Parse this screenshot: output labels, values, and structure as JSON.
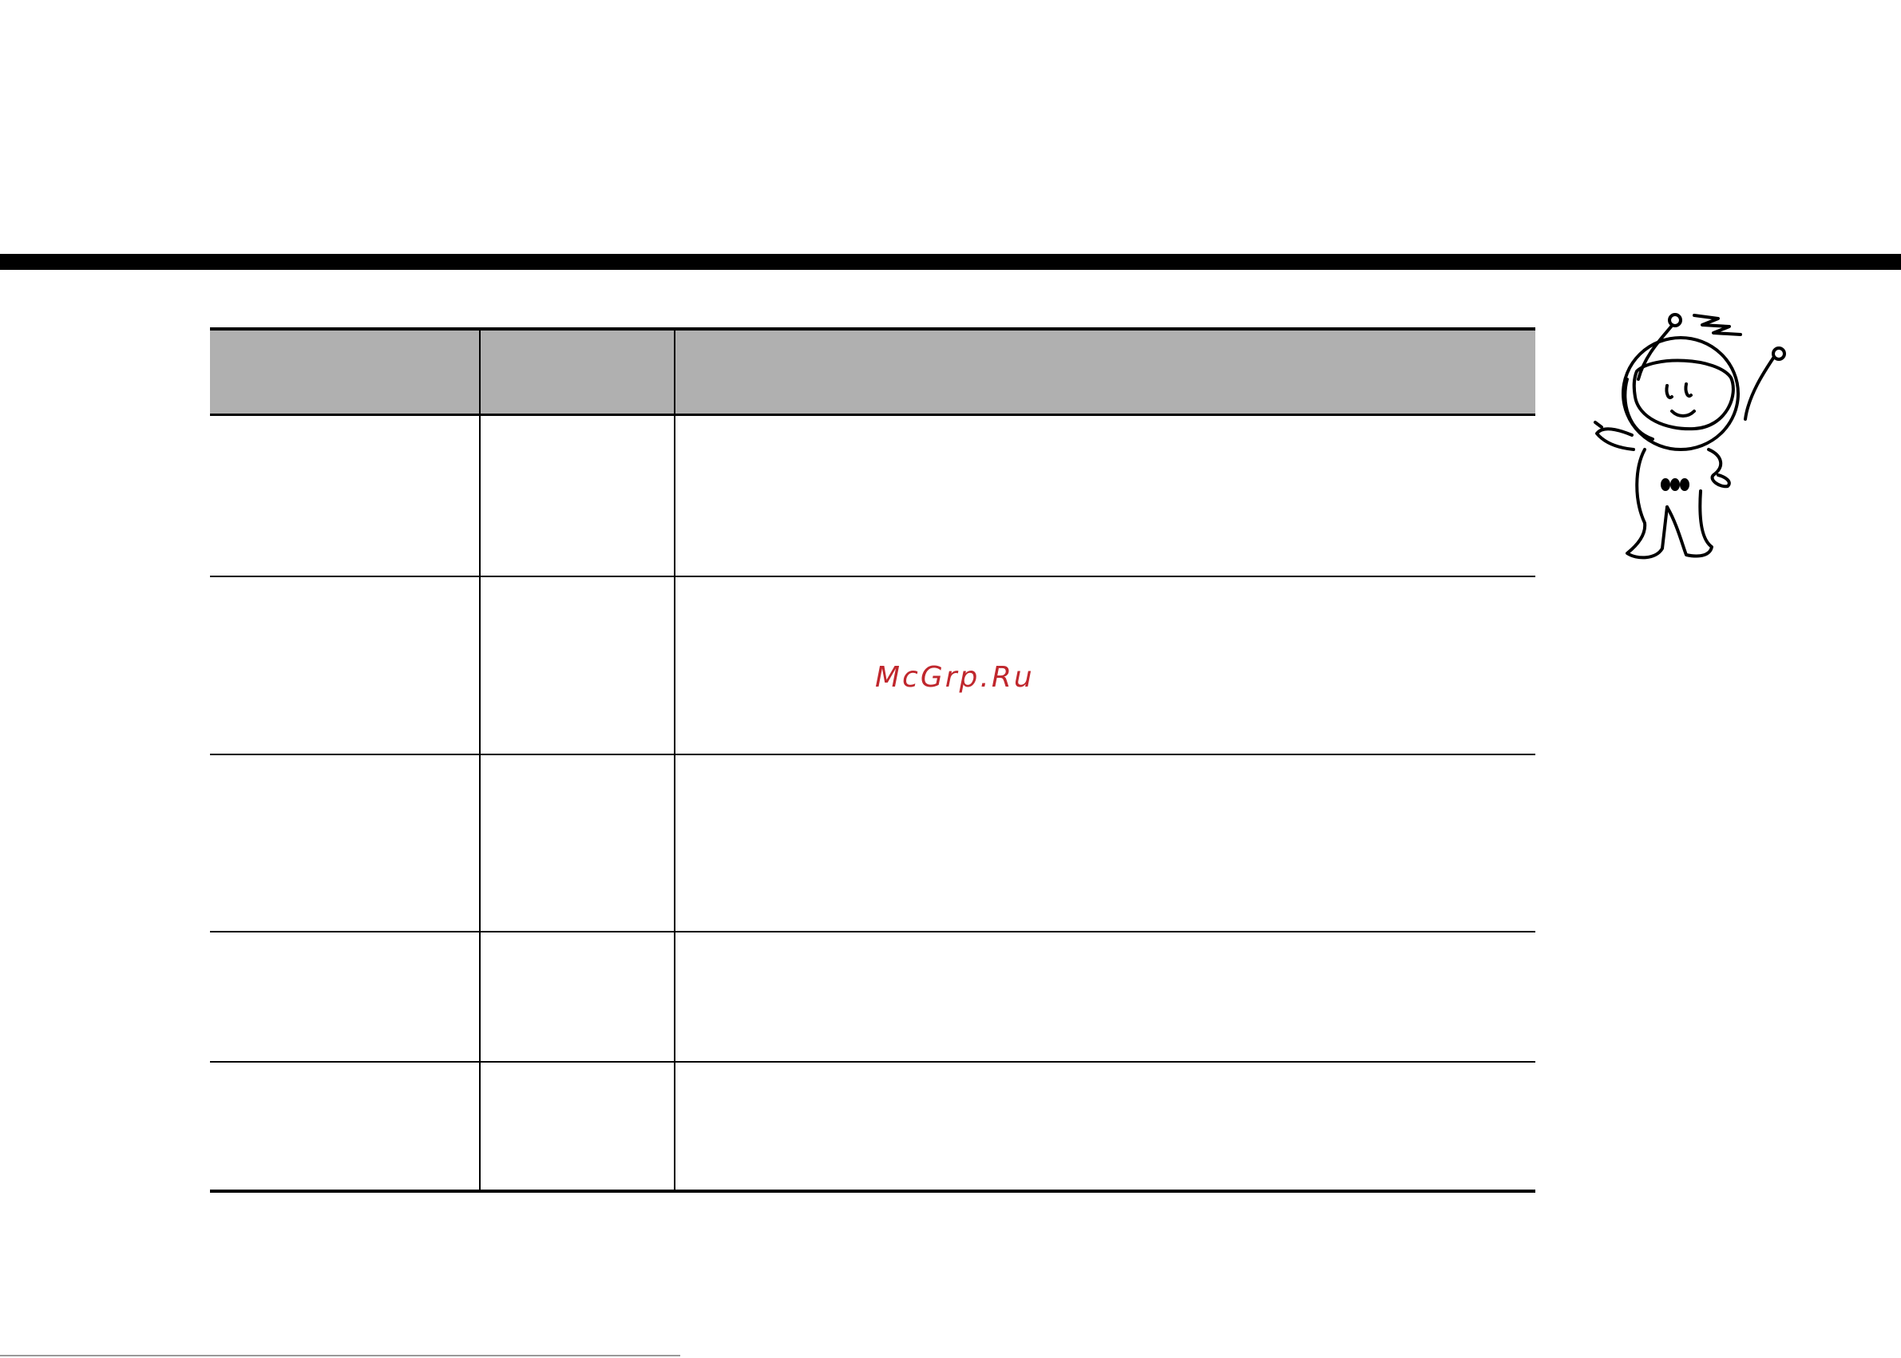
{
  "table": {
    "headers": [
      "",
      "",
      ""
    ],
    "rows": [
      [
        "",
        "",
        ""
      ],
      [
        "",
        "",
        ""
      ],
      [
        "",
        "",
        ""
      ],
      [
        "",
        "",
        ""
      ],
      [
        "",
        "",
        ""
      ]
    ]
  },
  "watermark": {
    "text": "McGrp.Ru",
    "color": "#c0272d"
  },
  "mascot": {
    "icon": "robot-mascot-icon"
  },
  "colors": {
    "header_fill": "#b0b0b0",
    "rule": "#000000"
  }
}
